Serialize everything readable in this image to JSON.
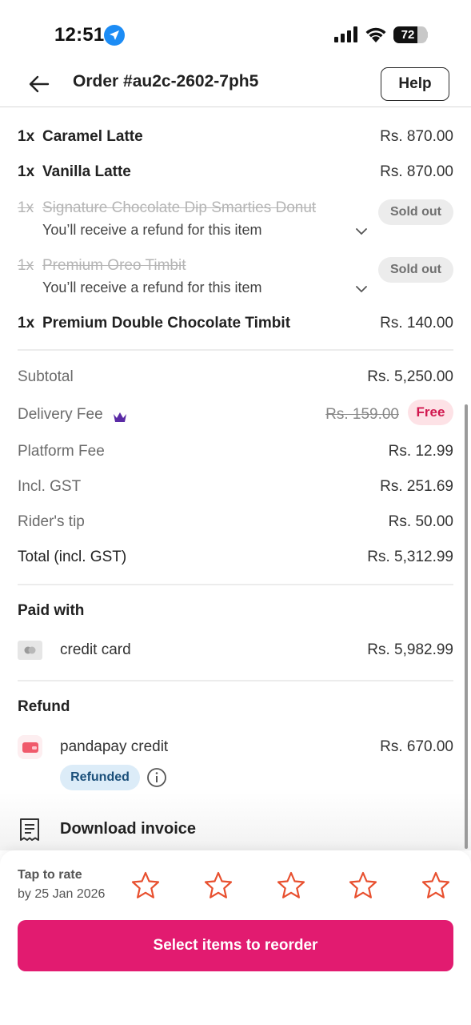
{
  "status_bar": {
    "time": "12:51",
    "battery": "72",
    "battery_level": 0.72,
    "icons": [
      "location-arrow-icon",
      "signal-icon",
      "wifi-icon",
      "battery-icon"
    ]
  },
  "header": {
    "title": "Order #au2c-2602-7ph5",
    "help_label": "Help",
    "back_icon": "back-arrow-icon"
  },
  "items": [
    {
      "qty": "1x",
      "name": "Caramel Latte",
      "price": "Rs. 870.00",
      "sold_out": false
    },
    {
      "qty": "1x",
      "name": "Vanilla Latte",
      "price": "Rs. 870.00",
      "sold_out": false
    },
    {
      "qty": "1x",
      "name": "Signature Chocolate Dip Smarties Donut",
      "sold_out": true,
      "badge": "Sold out",
      "note": "You’ll receive a refund for this item"
    },
    {
      "qty": "1x",
      "name": "Premium Oreo Timbit",
      "sold_out": true,
      "badge": "Sold out",
      "note": "You’ll receive a refund for this item"
    },
    {
      "qty": "1x",
      "name": "Premium Double Chocolate Timbit",
      "price": "Rs. 140.00",
      "sold_out": false
    }
  ],
  "bill": {
    "subtotal_label": "Subtotal",
    "subtotal_value": "Rs. 5,250.00",
    "delivery_label": "Delivery Fee",
    "delivery_old": "Rs. 159.00",
    "delivery_badge": "Free",
    "platform_label": "Platform Fee",
    "platform_value": "Rs. 12.99",
    "gst_label": "Incl. GST",
    "gst_value": "Rs. 251.69",
    "tip_label": "Rider's tip",
    "tip_value": "Rs. 50.00",
    "total_label": "Total (incl. GST)",
    "total_value": "Rs. 5,312.99"
  },
  "payment": {
    "title": "Paid with",
    "method": "credit card",
    "amount": "Rs. 5,982.99"
  },
  "refund": {
    "title": "Refund",
    "method": "pandapay credit",
    "amount": "Rs. 670.00",
    "badge": "Refunded"
  },
  "invoice": {
    "label": "Download invoice"
  },
  "rating": {
    "title": "Tap to rate",
    "deadline": "by 25 Jan 2026",
    "stars": 5,
    "star_color": "#e8502f"
  },
  "reorder": {
    "label": "Select items to reorder",
    "color": "#e21b70"
  }
}
